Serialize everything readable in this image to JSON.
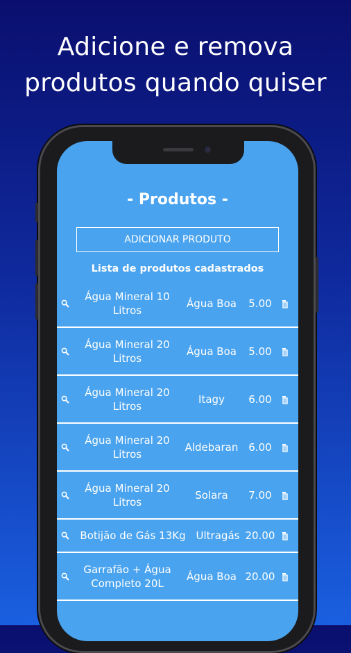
{
  "headline": {
    "line1": "Adicione e remova",
    "line2": "produtos quando quiser"
  },
  "screen": {
    "title": "- Produtos -",
    "add_button_label": "ADICIONAR PRODUTO",
    "list_title": "Lista de produtos cadastrados"
  },
  "products": [
    {
      "name_line1": "Água Mineral 10",
      "name_line2": "Litros",
      "brand": "Água Boa",
      "price": "5.00"
    },
    {
      "name_line1": "Água Mineral 20",
      "name_line2": "Litros",
      "brand": "Água Boa",
      "price": "5.00"
    },
    {
      "name_line1": "Água Mineral 20",
      "name_line2": "Litros",
      "brand": "Itagy",
      "price": "6.00"
    },
    {
      "name_line1": "Água Mineral 20",
      "name_line2": "Litros",
      "brand": "Aldebaran",
      "price": "6.00"
    },
    {
      "name_line1": "Água Mineral 20",
      "name_line2": "Litros",
      "brand": "Solara",
      "price": "7.00"
    },
    {
      "name": "Botijão de Gás 13Kg",
      "brand": "Ultragás",
      "price": "20.00"
    },
    {
      "name_line1": "Garrafão + Água",
      "name_line2": "Completo 20L",
      "brand": "Água Boa",
      "price": "20.00"
    }
  ],
  "colors": {
    "screen_bg": "#4aa3ee",
    "background_top": "#0a0f6e",
    "background_bottom": "#1a5fe0"
  },
  "icons": {
    "row_left": "search-icon",
    "row_right": "delete-icon"
  }
}
